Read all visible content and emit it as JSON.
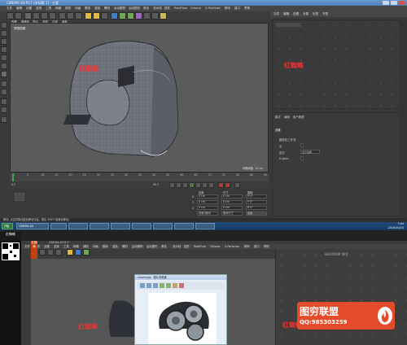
{
  "window": {
    "title": "CINEMA 4D R17 [未标题 1] - 主要"
  },
  "menubar": {
    "items": [
      "文件",
      "编辑",
      "创建",
      "选择",
      "工具",
      "网格",
      "捕捉",
      "动画",
      "模拟",
      "渲染",
      "雕刻",
      "运动跟踪",
      "运动图形",
      "角色",
      "流水线",
      "插件",
      "RealFlow",
      "Octane",
      "X-Particles",
      "脚本",
      "窗口",
      "帮助"
    ]
  },
  "viewport": {
    "menu": [
      "查看",
      "摄像机",
      "显示",
      "选项",
      "过滤",
      "面板"
    ],
    "label": "透视视图",
    "grid_info": "网格间距: 10 cm"
  },
  "right_panel": {
    "tabs": [
      "文件",
      "编辑",
      "查看",
      "对象",
      "标签",
      "书签"
    ],
    "attr_tabs": [
      "模式",
      "编辑",
      "用户数据"
    ],
    "attr_title": "选集",
    "attr_fields": [
      {
        "label": "模型化工作流",
        "value": ""
      },
      {
        "label": "点",
        "value": ""
      },
      {
        "label": "显示",
        "value": "显示选择"
      },
      {
        "label": "N-gons",
        "value": ""
      }
    ]
  },
  "timeline": {
    "ticks": [
      "0",
      "5",
      "10",
      "15",
      "20",
      "25",
      "30",
      "35",
      "40",
      "45",
      "50",
      "55",
      "60",
      "65",
      "70",
      "75",
      "80",
      "85",
      "90"
    ],
    "start": "0 F",
    "end": "90 F"
  },
  "coords": {
    "headers": [
      "位置",
      "尺寸",
      "旋转"
    ],
    "rows": [
      {
        "axis": "X",
        "pos": "0 cm",
        "size": "0 cm",
        "rot": "H 0°"
      },
      {
        "axis": "Y",
        "pos": "0 cm",
        "size": "0 cm",
        "rot": "P 0°"
      },
      {
        "axis": "Z",
        "pos": "0 cm",
        "size": "0 cm",
        "rot": "B 0°"
      }
    ],
    "buttons": [
      "对象(相对)",
      "绝对尺寸",
      "应用"
    ]
  },
  "statusbar": {
    "text": "移动: 点击并拖动鼠标移动元素。按住 SHIFT 键量化移动。"
  },
  "taskbar": {
    "items": [
      "开始",
      "CINEMA 4D",
      "",
      "",
      "",
      "",
      "",
      "",
      "",
      ""
    ],
    "clock_time": "7:44",
    "clock_date": "2016/10/24"
  },
  "watermark": {
    "brand": "红蜘蛛",
    "logo_main": "图穷联盟",
    "logo_qq": "QQ:985303259"
  },
  "second_shot": {
    "cam_title": "红蜘蛛",
    "banner": "红蜘蛛",
    "window_title": "CINEMA 4D R17",
    "dialog_title": "shaver.jpg - 图片查看器",
    "right_logo": "GOODUP 果艺"
  },
  "colors": {
    "watermark_bg": "#e34b2a",
    "brand_red": "#e33333",
    "taskbar": "#1f4b79"
  }
}
